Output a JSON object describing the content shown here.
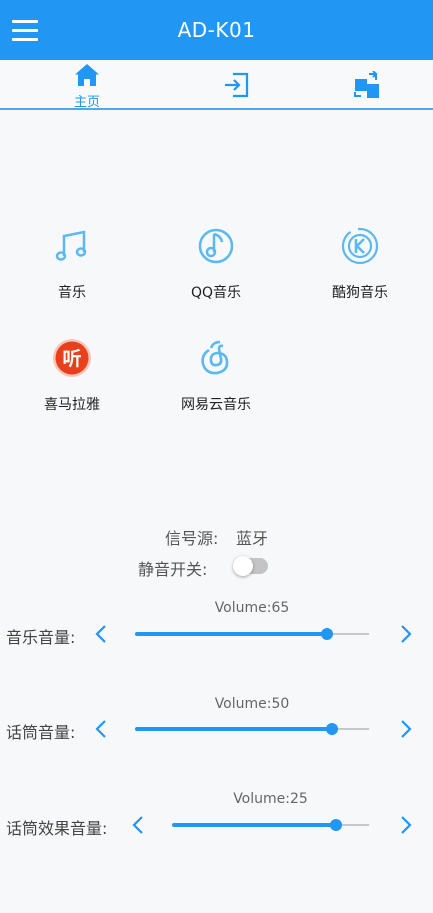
{
  "header": {
    "title": "AD-K01"
  },
  "tabs": [
    {
      "label": "主页",
      "active": true,
      "icon": "home-icon"
    },
    {
      "label": "",
      "active": false,
      "icon": "input-icon"
    },
    {
      "label": "",
      "active": false,
      "icon": "switch-icon"
    }
  ],
  "apps": [
    {
      "label": "音乐",
      "icon": "music-note-icon"
    },
    {
      "label": "QQ音乐",
      "icon": "qq-music-icon"
    },
    {
      "label": "酷狗音乐",
      "icon": "kugou-icon"
    },
    {
      "label": "喜马拉雅",
      "icon": "ximalaya-icon"
    },
    {
      "label": "网易云音乐",
      "icon": "netease-music-icon"
    }
  ],
  "status": {
    "signal_source_label": "信号源:",
    "signal_source_value": "蓝牙",
    "mute_label": "静音开关:",
    "mute_on": false
  },
  "volumes": [
    {
      "label": "音乐音量:",
      "value_text": "Volume:65",
      "level": 0.82
    },
    {
      "label": "话筒音量:",
      "value_text": "Volume:50",
      "level": 0.84
    },
    {
      "label": "话筒效果音量:",
      "value_text": "Volume:25",
      "level": 0.83
    }
  ],
  "colors": {
    "accent": "#2196f3",
    "topbar": "#2196f3",
    "ximalaya_red": "#e8401c"
  }
}
